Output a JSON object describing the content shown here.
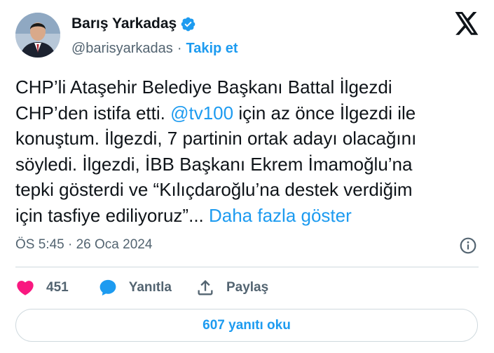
{
  "author": {
    "name": "Barış Yarkadaş",
    "handle": "@barisyarkadas",
    "separator": "·",
    "follow_label": "Takip et",
    "verified": true
  },
  "tweet": {
    "text_part1": "CHP’li Ataşehir Belediye Başkanı Battal İlgezdi\nCHP’den istifa etti. ",
    "mention": "@tv100",
    "text_part2": " için az önce İlgezdi ile\nkonuştum. İlgezdi, 7 partinin ortak adayı olacağını\nsöyledi. İlgezdi, İBB Başkanı Ekrem İmamoğlu’na\ntepki gösterdi ve “Kılıçdaroğlu’na destek verdiğim\niçin tasfiye ediliyoruz”... ",
    "show_more": "Daha fazla göster",
    "timestamp": "ÖS 5:45 · 26 Oca 2024"
  },
  "actions": {
    "like_count": "451",
    "reply_label": "Yanıtla",
    "share_label": "Paylaş"
  },
  "read_replies_label": "607 yanıtı oku",
  "colors": {
    "accent": "#1d9bf0",
    "like": "#f91880",
    "secondary_text": "#536471"
  },
  "icons": [
    "avatar",
    "verified-badge-icon",
    "x-logo-icon",
    "info-icon",
    "heart-icon",
    "reply-bubble-icon",
    "share-icon"
  ]
}
